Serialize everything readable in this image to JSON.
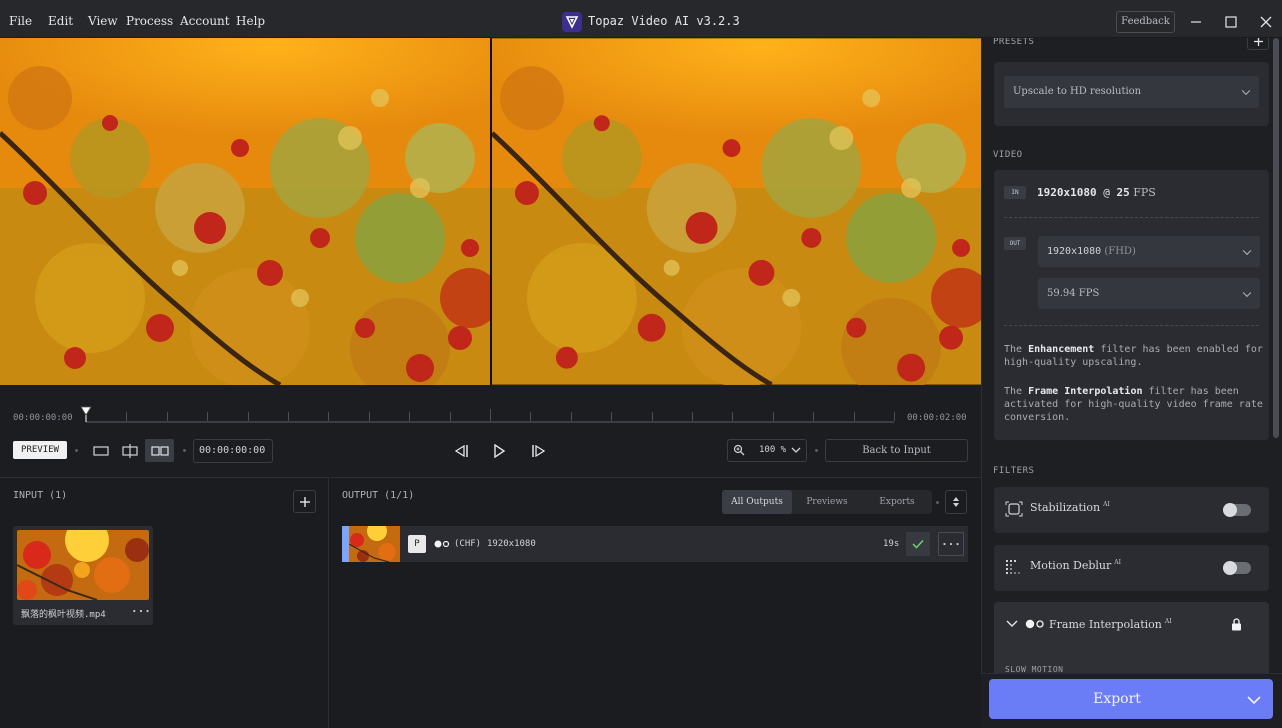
{
  "menu": [
    "File",
    "Edit",
    "View",
    "Process",
    "Account",
    "Help"
  ],
  "app": {
    "title": "Topaz Video AI  v3.2.3",
    "feedback": "Feedback"
  },
  "timeline": {
    "start": "00:00:00:00",
    "end": "00:00:02:00",
    "preview_label": "PREVIEW",
    "current_time": "00:00:00:00",
    "zoom": "100 %",
    "back_to_input": "Back to Input"
  },
  "input": {
    "title": "INPUT (1)",
    "filename": "飘落的枫叶视频.mp4"
  },
  "output": {
    "title": "OUTPUT (1/1)",
    "tabs": [
      "All Outputs",
      "Previews",
      "Exports"
    ],
    "row": {
      "badge": "P",
      "codec": "(CHF)",
      "resolution": "1920x1080",
      "duration": "19s"
    }
  },
  "sidebar": {
    "presets_label": "PRESETS",
    "preset_value": "Upscale to HD resolution",
    "video_label": "VIDEO",
    "in_tag": "IN",
    "out_tag": "OUT",
    "in_res": "1920x1080",
    "in_at": " @ ",
    "in_fps_num": "25",
    "in_fps_unit": " FPS",
    "out_resolution": "1920x1080",
    "out_resolution_suffix": "(FHD)",
    "out_fps": "59.94 FPS",
    "info1_pre": "The ",
    "info1_bold": "Enhancement",
    "info1_post": " filter has been enabled for high-quality upscaling.",
    "info2_pre": "The ",
    "info2_bold": "Frame Interpolation",
    "info2_post": " filter has been activated for high-quality video frame rate conversion.",
    "filters_label": "FILTERS",
    "filters": [
      {
        "name": "Stabilization",
        "ai": "AI"
      },
      {
        "name": "Motion Deblur",
        "ai": "AI"
      },
      {
        "name": "Frame Interpolation",
        "ai": "AI"
      }
    ],
    "slow_motion_label": "SLOW MOTION",
    "export": "Export"
  }
}
